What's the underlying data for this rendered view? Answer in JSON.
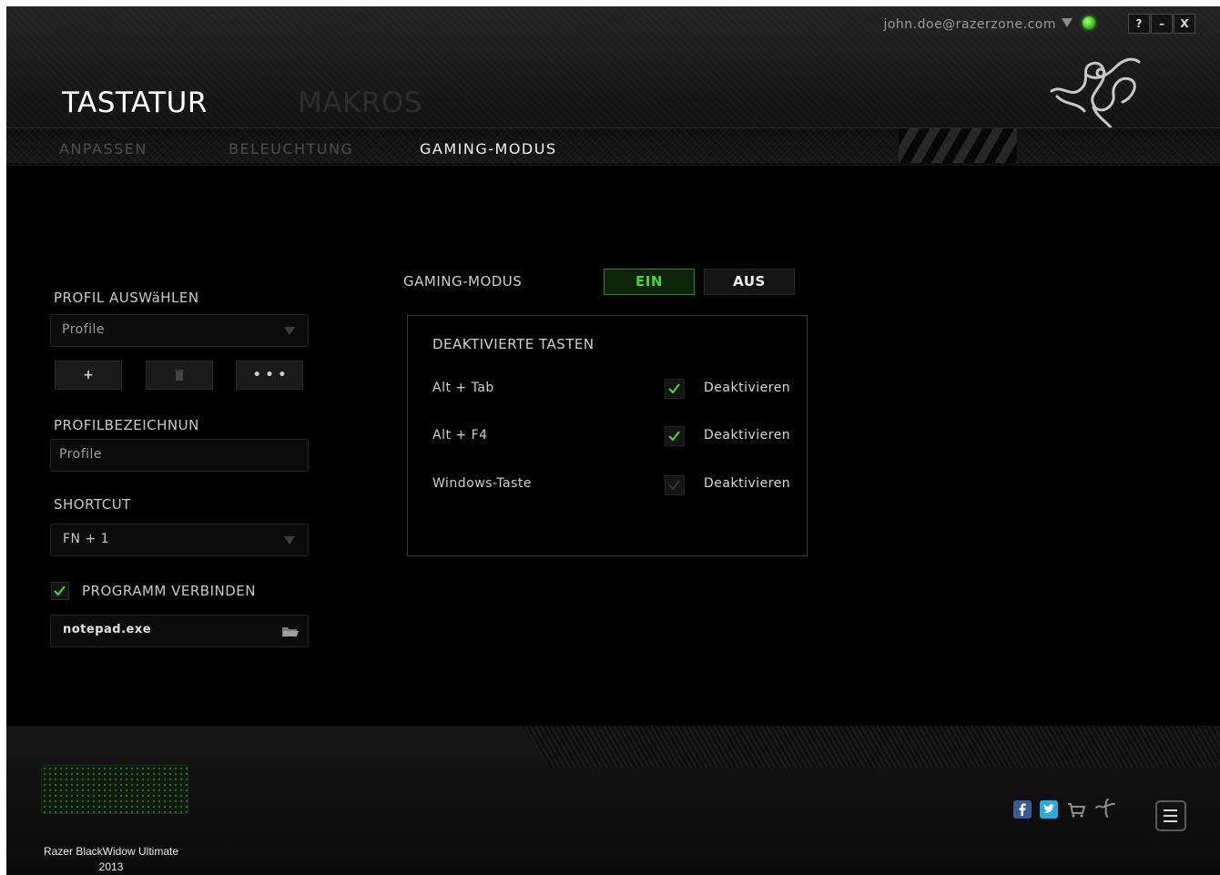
{
  "header": {
    "account_email": "john.doe@razerzone.com",
    "help_label": "?",
    "minimize_label": "–",
    "close_label": "X",
    "tabs": [
      {
        "label": "TASTATUR",
        "active": true
      },
      {
        "label": "MAKROS",
        "active": false
      }
    ],
    "subtabs": [
      {
        "label": "ANPASSEN",
        "active": false
      },
      {
        "label": "BELEUCHTUNG",
        "active": false
      },
      {
        "label": "GAMING-MODUS",
        "active": true
      }
    ]
  },
  "profile": {
    "select_label": "PROFIL AUSWäHLEN",
    "selected_profile": "Profile",
    "add_label": "+",
    "delete_label": "▥",
    "more_label": "• • •",
    "name_label": "PROFILBEZEICHNUN",
    "name_value": "Profile",
    "shortcut_label": "SHORTCUT",
    "shortcut_value": "FN + 1",
    "link_program_label": "PROGRAMM VERBINDEN",
    "link_program_checked": true,
    "program_value": "notepad.exe"
  },
  "gaming_mode": {
    "label": "GAMING-MODUS",
    "on_label": "EIN",
    "off_label": "AUS",
    "state": "on",
    "disabled_keys_title": "DEAKTIVIERTE TASTEN",
    "keys": [
      {
        "name": "Alt + Tab",
        "action": "Deaktivieren",
        "checked": true
      },
      {
        "name": "Alt + F4",
        "action": "Deaktivieren",
        "checked": true
      },
      {
        "name": "Windows-Taste",
        "action": "Deaktivieren",
        "checked": false
      }
    ]
  },
  "footer": {
    "device_name": "Razer BlackWidow Ultimate",
    "device_year": "2013"
  },
  "colors": {
    "accent": "#44d62c",
    "background": "#000000",
    "text": "#c8c8c8"
  },
  "icons": [
    "facebook-icon",
    "twitter-icon",
    "cart-icon",
    "razer-icon",
    "menu-icon",
    "folder-icon",
    "checkmark-icon",
    "trash-icon"
  ]
}
